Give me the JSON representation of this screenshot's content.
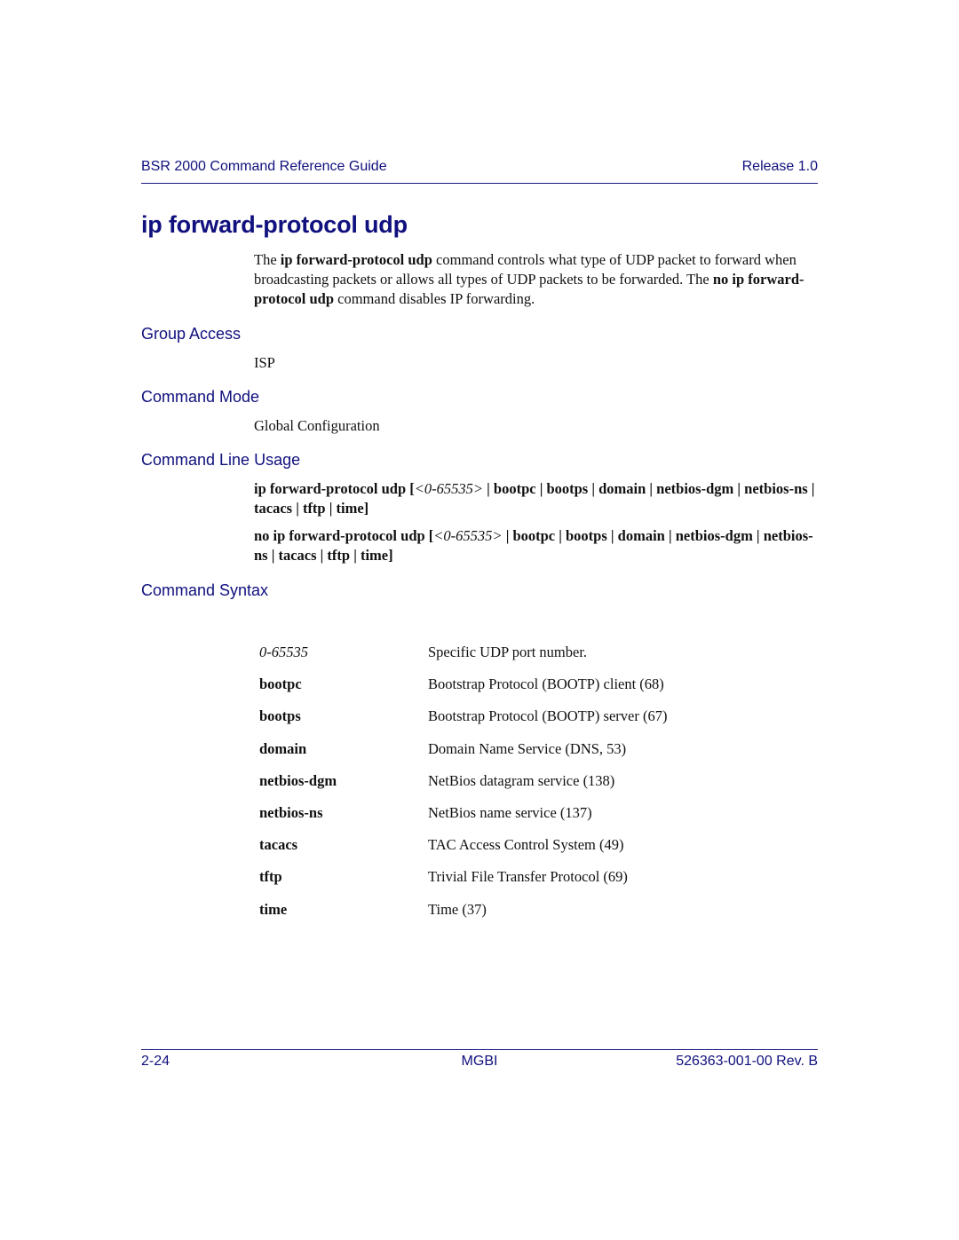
{
  "header": {
    "guide_title": "BSR 2000 Command Reference Guide",
    "release": "Release 1.0"
  },
  "title": "ip forward-protocol udp",
  "intro": {
    "t1": "The ",
    "b1": "ip forward-protocol udp",
    "t2": " command controls what type of UDP packet to forward when broadcasting packets or allows all types of UDP packets to be forwarded. The ",
    "b2": "no ip forward-protocol udp",
    "t3": " command disables IP forwarding."
  },
  "sections": {
    "group_access": {
      "heading": "Group Access",
      "value": "ISP"
    },
    "command_mode": {
      "heading": "Command Mode",
      "value": "Global Configuration"
    },
    "command_line_usage": {
      "heading": "Command Line Usage",
      "usage1": {
        "prefix": "ip forward-protocol udp [",
        "arg": "<0-65535>",
        "suffix": " | bootpc | bootps | domain | netbios-dgm | netbios-ns | tacacs | tftp | time]"
      },
      "usage2": {
        "prefix": "no ip forward-protocol udp [",
        "arg": "<0-65535>",
        "suffix": " | bootpc | bootps | domain | netbios-dgm | netbios-ns | tacacs | tftp | time]"
      }
    },
    "command_syntax": {
      "heading": "Command Syntax",
      "rows": [
        {
          "param": "0-65535",
          "desc": "Specific UDP port number."
        },
        {
          "param": "bootpc",
          "desc": "Bootstrap Protocol (BOOTP) client (68)"
        },
        {
          "param": "bootps",
          "desc": "Bootstrap Protocol (BOOTP) server (67)"
        },
        {
          "param": "domain",
          "desc": "Domain Name Service (DNS, 53)"
        },
        {
          "param": "netbios-dgm",
          "desc": "NetBios datagram service (138)"
        },
        {
          "param": "netbios-ns",
          "desc": "NetBios name service (137)"
        },
        {
          "param": "tacacs",
          "desc": "TAC Access Control System (49)"
        },
        {
          "param": "tftp",
          "desc": "Trivial File Transfer Protocol (69)"
        },
        {
          "param": "time",
          "desc": "Time (37)"
        }
      ]
    }
  },
  "footer": {
    "page_number": "2-24",
    "company": "MGBI",
    "doc_number": "526363-001-00 Rev. B"
  }
}
